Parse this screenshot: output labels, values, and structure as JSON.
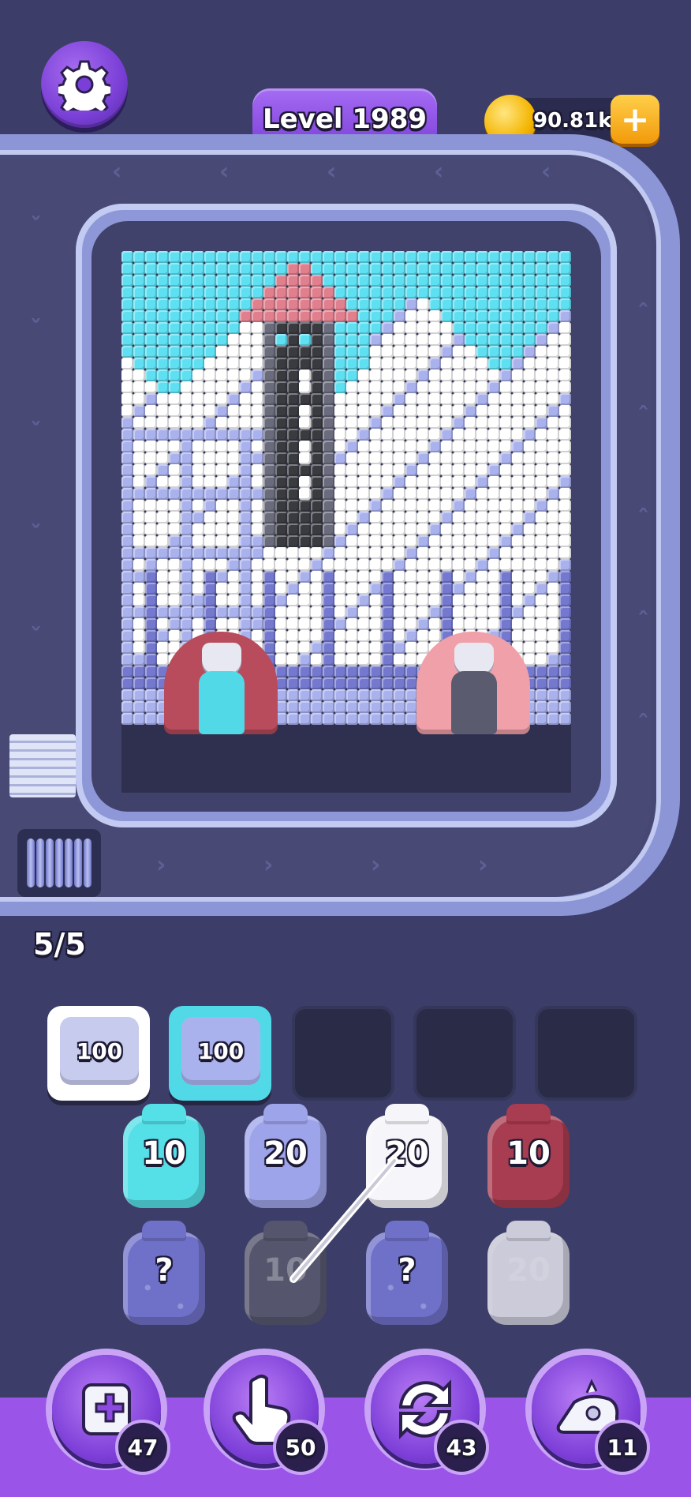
{
  "header": {
    "level_label": "Level 1989",
    "coins": "90.81k",
    "coin_plus": "+"
  },
  "queue": {
    "count": "5/5"
  },
  "slots": [
    {
      "label": "100",
      "state": "filled",
      "color": "#ffffff",
      "border": "#ffffff"
    },
    {
      "label": "100",
      "state": "filled",
      "color": "#52d9e8",
      "border": "#52d9e8"
    },
    {
      "label": "",
      "state": "empty"
    },
    {
      "label": "",
      "state": "empty"
    },
    {
      "label": "",
      "state": "empty"
    }
  ],
  "grid_rows": [
    [
      {
        "label": "10",
        "color": "#55dfe6"
      },
      {
        "label": "20",
        "color": "#9ea4ea"
      },
      {
        "label": "20",
        "color": "#f6f6fa"
      },
      {
        "label": "10",
        "color": "#a83c50"
      }
    ],
    [
      {
        "label": "?",
        "color": "#6f71c9",
        "mystery": true
      },
      {
        "label": "10",
        "color": "#5a5b6e",
        "dim": true
      },
      {
        "label": "?",
        "color": "#6f71c9",
        "mystery": true
      },
      {
        "label": "20",
        "color": "#e4e4ee",
        "dim": true
      }
    ]
  ],
  "boosters": [
    {
      "name": "add-slot",
      "count": "47"
    },
    {
      "name": "hand",
      "count": "50"
    },
    {
      "name": "shuffle",
      "count": "43"
    },
    {
      "name": "vacuum",
      "count": "11"
    }
  ],
  "colors": {
    "sky": "#5ee0f2",
    "snow": "#ffffff",
    "lavender": "#aab2ee",
    "periwinkle": "#7479cf",
    "tower_dark": "#3a3b40",
    "tower_grey": "#6a6b7c",
    "roof": "#e07f8d",
    "accent_purple": "#8c4ae0"
  },
  "board": {
    "cols": 38,
    "rows": 40,
    "pigs": [
      {
        "color": "#b84c5c",
        "face_body": "#52d9e8"
      },
      {
        "color": "#f0a0a8",
        "face_body": "#5a5b6e"
      }
    ]
  }
}
